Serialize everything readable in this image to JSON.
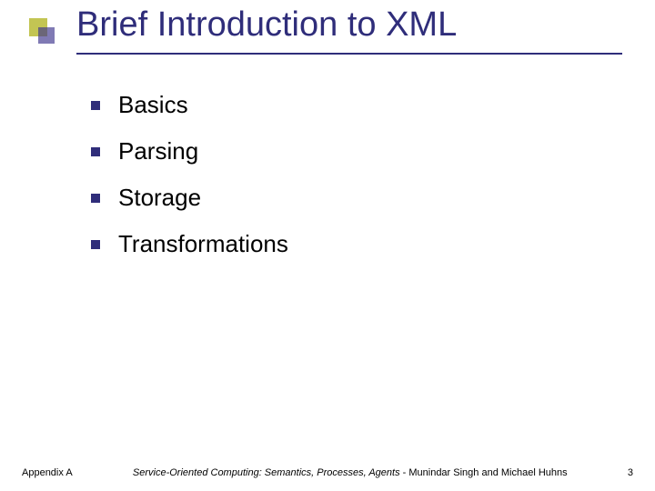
{
  "title": "Brief Introduction to XML",
  "bullets": {
    "b0": "Basics",
    "b1": "Parsing",
    "b2": "Storage",
    "b3": "Transformations"
  },
  "footer": {
    "left": "Appendix A",
    "center_italic": "Service-Oriented Computing: Semantics, Processes, Agents",
    "center_rest": " - Munindar Singh and Michael Huhns",
    "right": "3"
  }
}
